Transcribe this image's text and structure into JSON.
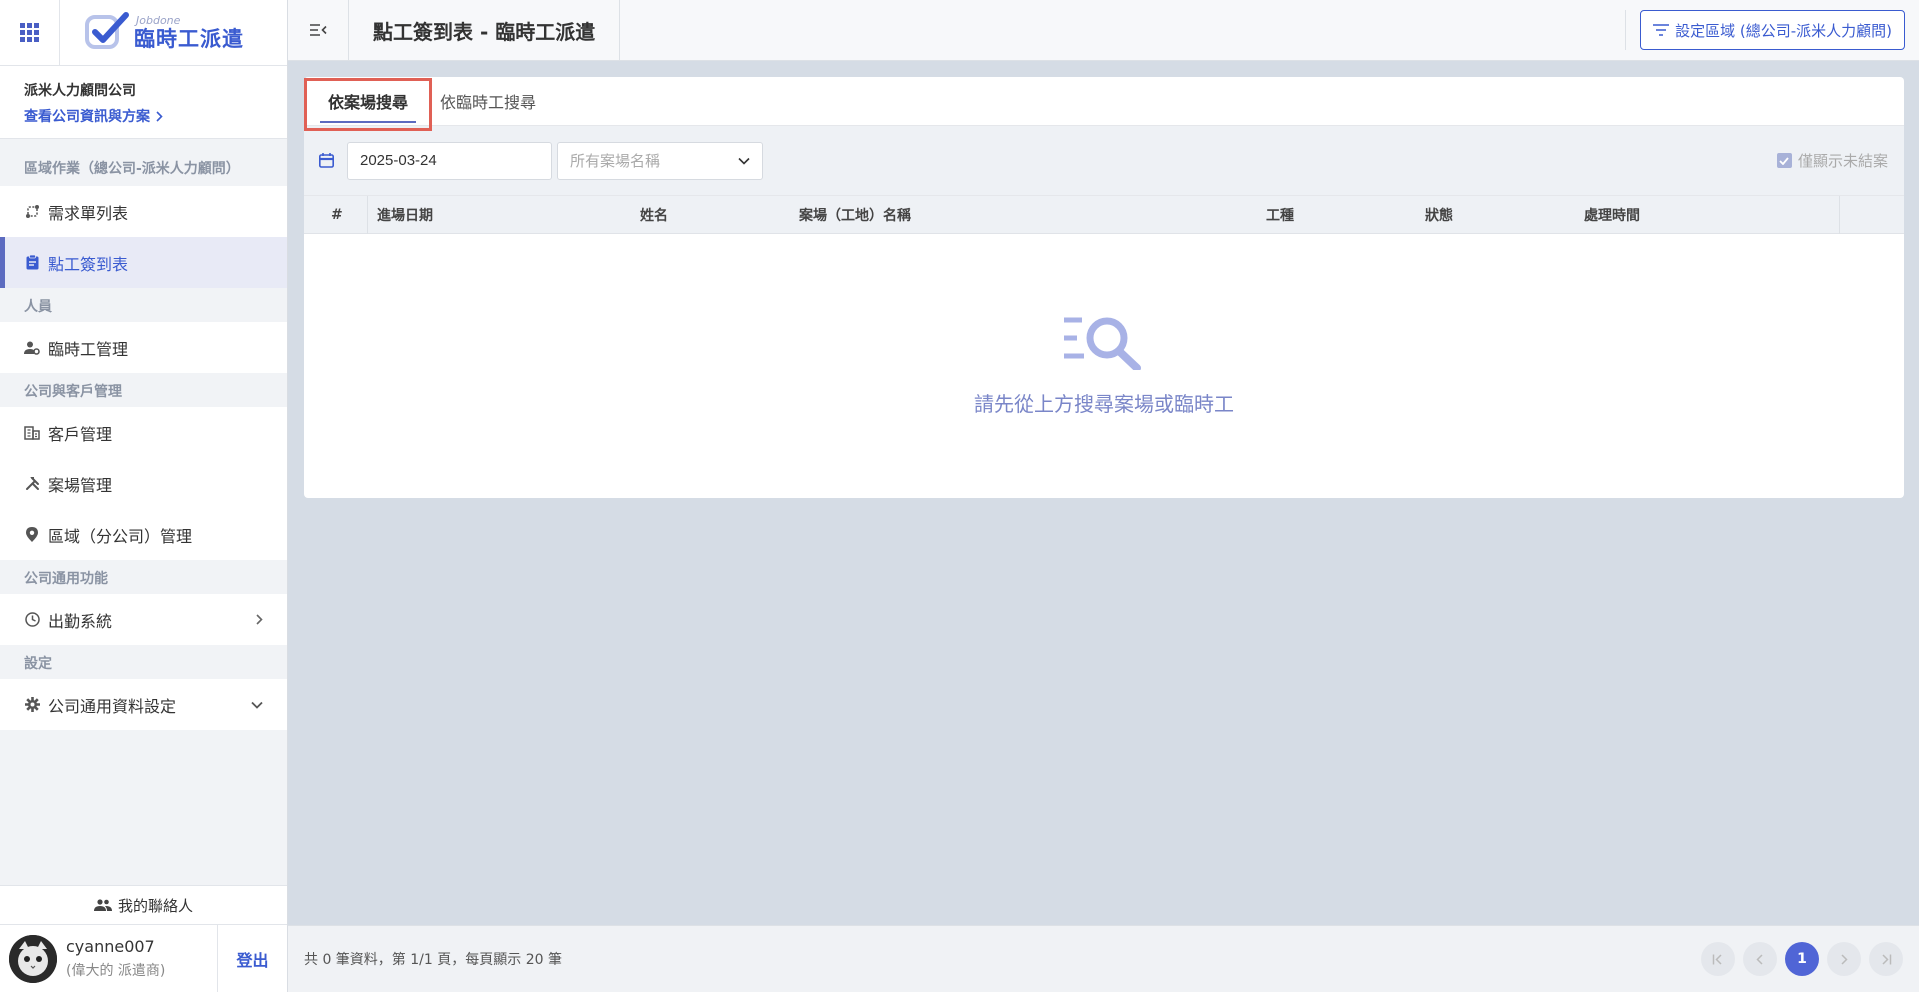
{
  "app": {
    "logo_small": "Jobdone",
    "logo_big": "臨時工派遣"
  },
  "company": {
    "name": "派米人力顧問公司",
    "link": "查看公司資訊與方案"
  },
  "sidebar": {
    "sections": [
      {
        "title": "區域作業（總公司-派米人力顧問）"
      },
      {
        "title": "人員"
      },
      {
        "title": "公司與客戶管理"
      },
      {
        "title": "公司通用功能"
      },
      {
        "title": "設定"
      }
    ],
    "items": [
      {
        "label": "需求單列表",
        "icon": "route-icon"
      },
      {
        "label": "點工簽到表",
        "icon": "clipboard-icon",
        "active": true
      },
      {
        "label": "臨時工管理",
        "icon": "user-gear-icon"
      },
      {
        "label": "客戶管理",
        "icon": "building-icon"
      },
      {
        "label": "案場管理",
        "icon": "tools-icon"
      },
      {
        "label": "區域（分公司）管理",
        "icon": "location-pin-icon"
      },
      {
        "label": "出勤系統",
        "icon": "clock-icon"
      },
      {
        "label": "公司通用資料設定",
        "icon": "gear-icon"
      }
    ],
    "contacts_label": "我的聯絡人",
    "user": {
      "name": "cyanne007",
      "role": "(偉大的 派遣商)"
    },
    "logout_label": "登出"
  },
  "header": {
    "title": "點工簽到表 - 臨時工派遣",
    "region_button": "設定區域 (總公司-派米人力顧問)"
  },
  "tabs": [
    {
      "label": "依案場搜尋",
      "active": true
    },
    {
      "label": "依臨時工搜尋",
      "active": false
    }
  ],
  "filters": {
    "date": "2025-03-24",
    "site_placeholder": "所有案場名稱",
    "only_open_label": "僅顯示未結案",
    "only_open_checked": true
  },
  "table": {
    "columns": [
      "#",
      "進場日期",
      "姓名",
      "案場（工地）名稱",
      "工種",
      "狀態",
      "處理時間"
    ],
    "rows": []
  },
  "empty_state": {
    "message": "請先從上方搜尋案場或臨時工"
  },
  "footer": {
    "page_info": "共 0 筆資料，第 1/1 頁，每頁顯示 20 筆",
    "current_page": "1"
  },
  "colors": {
    "accent": "#3a5bd0",
    "highlight_box": "#e06055",
    "empty_text": "#7a86c8"
  }
}
